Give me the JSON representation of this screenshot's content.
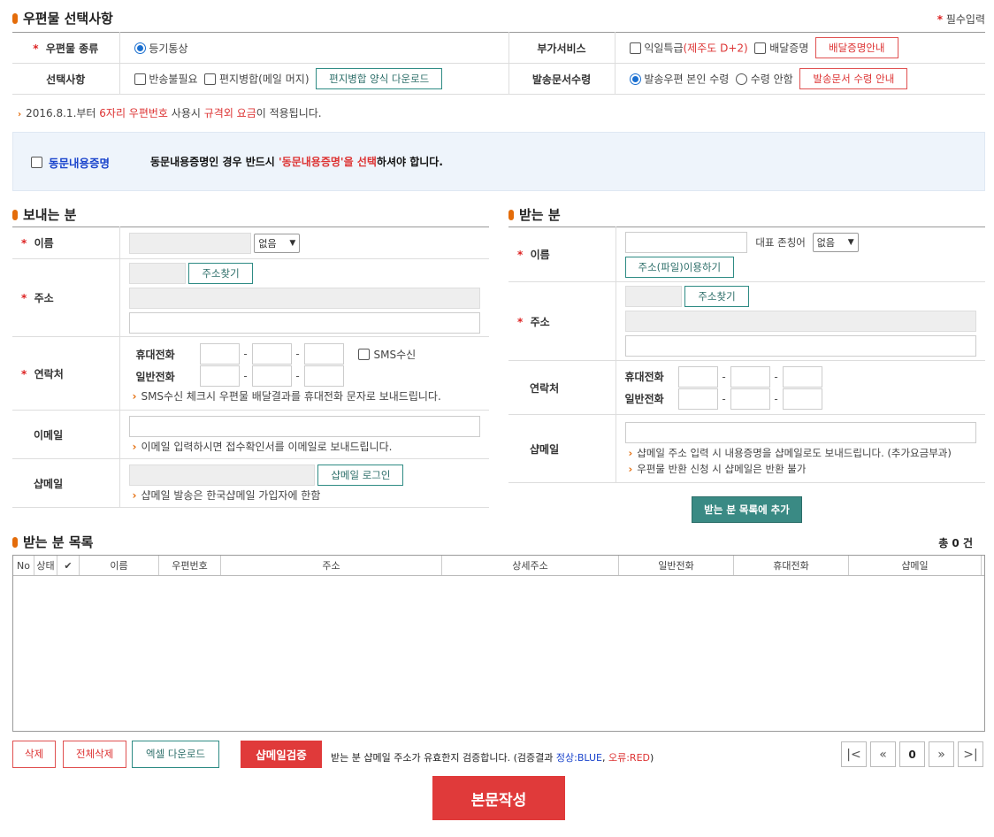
{
  "postal": {
    "title": "우편물 선택사항",
    "required_label": "필수입력",
    "kind_label": "우편물 종류",
    "kind_value": "등기통상",
    "addon_label": "부가서비스",
    "addon_next_day": "익일특급",
    "addon_next_day_note": "(제주도 D+2)",
    "addon_delivery_proof": "배달증명",
    "addon_guide_button": "배달증명안내",
    "option_label": "선택사항",
    "option_no_return": "반송불필요",
    "option_merge": "편지병합(메일 머지)",
    "option_merge_download": "편지병합 양식 다운로드",
    "receive_label": "발송문서수령",
    "receive_self": "발송우편 본인 수령",
    "receive_none": "수령 안함",
    "receive_guide_button": "발송문서 수령 안내"
  },
  "notice": {
    "prefix": "2016.8.1.부터 ",
    "six_digit": "6자리 우편번호",
    "middle": " 사용시 ",
    "extra_fee": "규격외 요금",
    "suffix": "이 적용됩니다."
  },
  "duplicate": {
    "checkbox_label": "동문내용증명",
    "msg_prefix": "동문내용증명인 경우 반드시 ",
    "msg_highlight": "'동문내용증명'을 선택",
    "msg_suffix": "하셔야 합니다."
  },
  "sender": {
    "title": "보내는 분",
    "name_label": "이름",
    "honorific_value": "없음",
    "address_label": "주소",
    "address_search": "주소찾기",
    "contact_label": "연락처",
    "mobile_label": "휴대전화",
    "phone_label": "일반전화",
    "sms_label": "SMS수신",
    "sms_note": "SMS수신 체크시 우편물 배달결과를 휴대전화 문자로 보내드립니다.",
    "email_label": "이메일",
    "email_note": "이메일 입력하시면 접수확인서를 이메일로 보내드립니다.",
    "shopmail_label": "샵메일",
    "shopmail_login": "샵메일 로그인",
    "shopmail_note": "샵메일 발송은 한국샵메일 가입자에 한함"
  },
  "receiver": {
    "title": "받는 분",
    "name_label": "이름",
    "honorific_label": "대표 존칭어",
    "honorific_value": "없음",
    "file_button": "주소(파일)이용하기",
    "address_label": "주소",
    "address_search": "주소찾기",
    "contact_label": "연락처",
    "mobile_label": "휴대전화",
    "phone_label": "일반전화",
    "shopmail_label": "샵메일",
    "shopmail_note1": "샵메일 주소 입력 시 내용증명을 샵메일로도 보내드립니다. (추가요금부과)",
    "shopmail_note2": "우편물 반환 신청 시 샵메일은 반환 불가",
    "add_button": "받는 분 목록에 추가"
  },
  "list": {
    "title": "받는 분 목록",
    "total": "총 0 건",
    "columns": [
      "No",
      "상태",
      "✔",
      "이름",
      "우편번호",
      "주소",
      "상세주소",
      "일반전화",
      "휴대전화",
      "샵메일"
    ]
  },
  "actions": {
    "delete": "삭제",
    "delete_all": "전체삭제",
    "excel_download": "엑셀 다운로드",
    "verify": "샵메일검증",
    "verify_note_prefix": "받는 분 샵메일 주소가 유효한지 검증합니다. (검증결과 ",
    "verify_ok": "정상:BLUE",
    "verify_sep": ", ",
    "verify_err": "오류:RED",
    "verify_note_suffix": ")",
    "page_number": "0",
    "write_button": "본문작성"
  },
  "colors": {
    "accent": "#e46c0a",
    "teal": "#3a8a84",
    "red": "#e03a3a",
    "blue": "#1a44cc"
  }
}
